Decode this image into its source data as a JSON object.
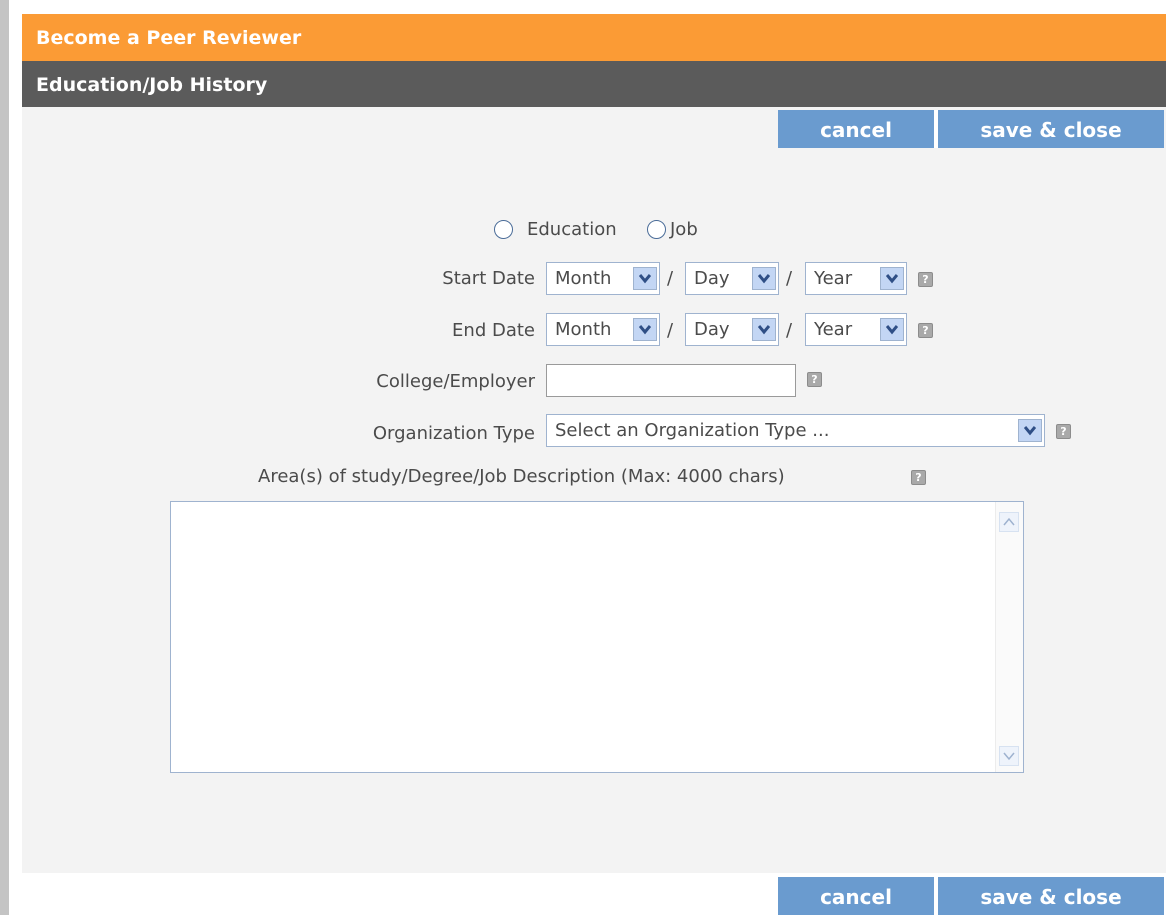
{
  "window": {
    "title": "Become a Peer Reviewer",
    "section_title": "Education/Job History"
  },
  "toolbar": {
    "cancel_label": "cancel",
    "save_close_label": "save & close"
  },
  "form": {
    "type_options": [
      "Education",
      "Job"
    ],
    "start_date": {
      "label": "Start Date",
      "month": "Month",
      "day": "Day",
      "year": "Year"
    },
    "end_date": {
      "label": "End Date",
      "month": "Month",
      "day": "Day",
      "year": "Year"
    },
    "separator": "/",
    "college_employer": {
      "label": "College/Employer",
      "value": ""
    },
    "organization_type": {
      "label": "Organization Type",
      "selected": "Select an Organization Type ..."
    },
    "description": {
      "label": "Area(s) of study/Degree/Job Description (Max: 4000 chars)",
      "value": ""
    }
  },
  "colors": {
    "header_orange": "#fb9b35",
    "header_dark": "#5b5b5b",
    "button_blue": "#6a9bcf",
    "panel_bg": "#f3f3f3"
  }
}
